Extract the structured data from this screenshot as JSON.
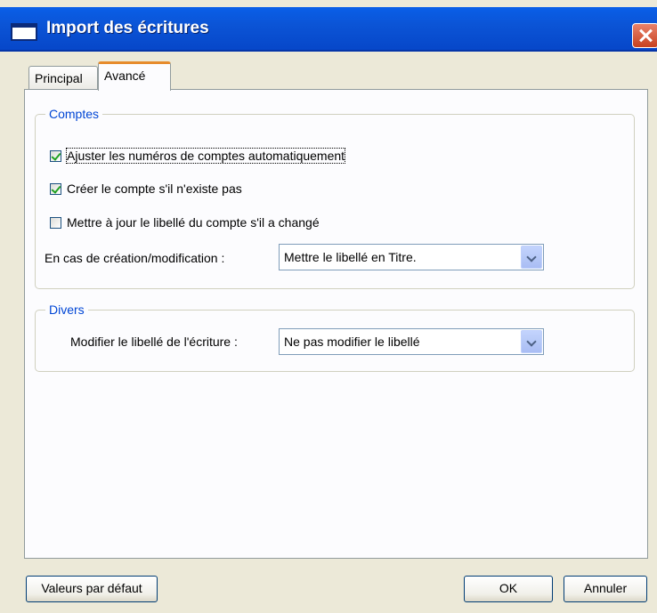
{
  "window": {
    "title": "Import des écritures"
  },
  "tabs": [
    {
      "label": "Principal",
      "active": false
    },
    {
      "label": "Avancé",
      "active": true
    }
  ],
  "comptes": {
    "legend": "Comptes",
    "checkboxes": [
      {
        "label": "Ajuster les numéros de comptes automatiquement",
        "checked": true
      },
      {
        "label": "Créer le compte s'il n'existe pas",
        "checked": true
      },
      {
        "label": "Mettre à jour le libellé du compte s'il a changé",
        "checked": false
      }
    ],
    "mode_label": "En cas de création/modification :",
    "mode_value": "Mettre le libellé en Titre."
  },
  "divers": {
    "legend": "Divers",
    "libelle_label": "Modifier le libellé de l'écriture :",
    "libelle_value": "Ne pas modifier le libellé"
  },
  "buttons": {
    "defaults": "Valeurs par défaut",
    "ok": "OK",
    "cancel": "Annuler"
  },
  "colors": {
    "titlebar": "#0b54d6",
    "legend": "#0046d5",
    "active_tab_accent": "#e68b2c"
  }
}
